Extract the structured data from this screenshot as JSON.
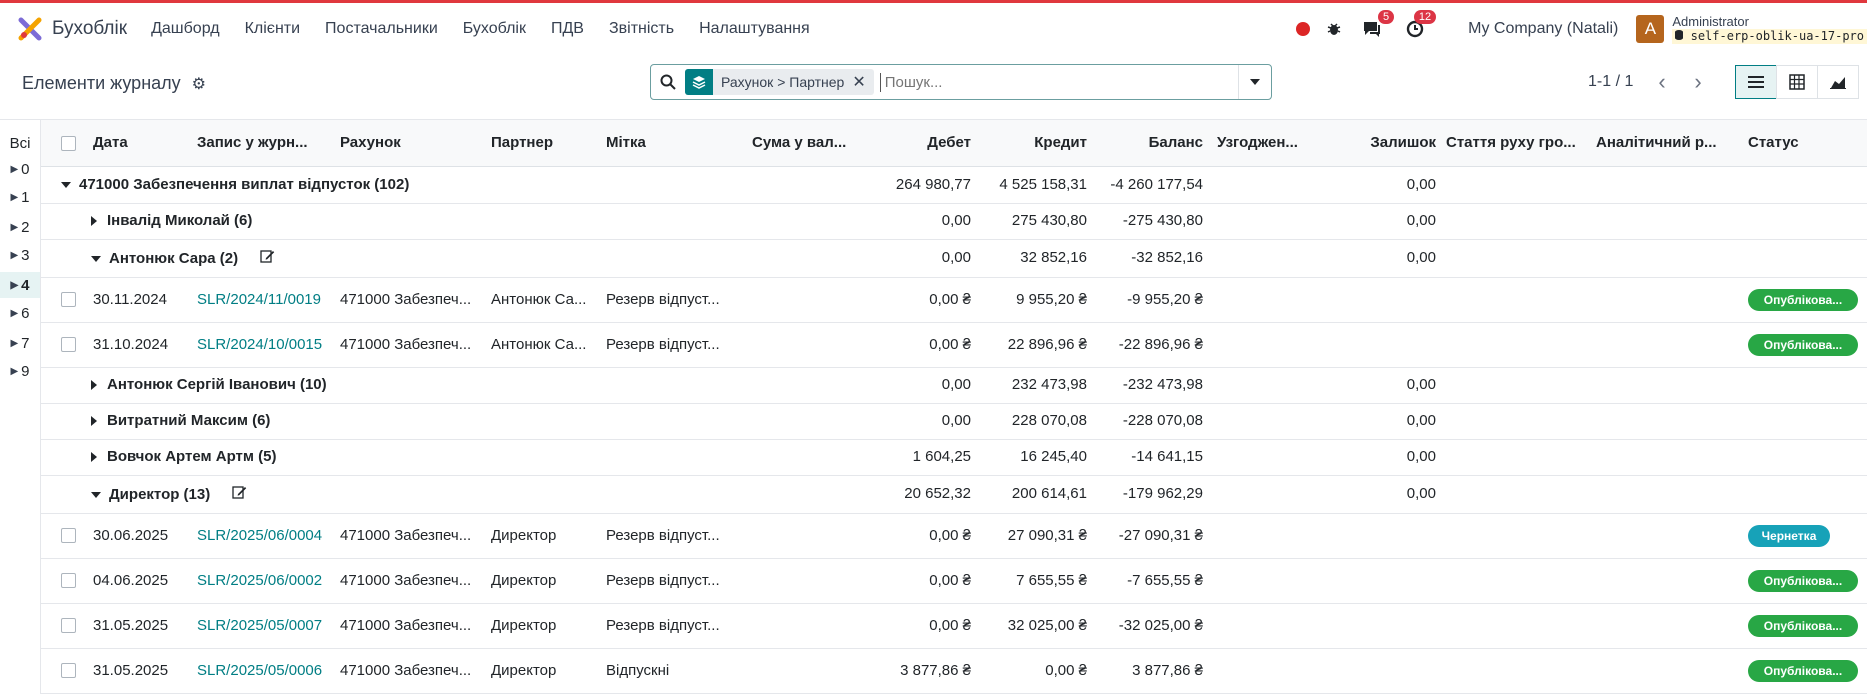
{
  "app": {
    "brand": "Бухоблік",
    "menu": [
      "Дашборд",
      "Клієнти",
      "Постачальники",
      "Бухоблік",
      "ПДВ",
      "Звітність",
      "Налаштування"
    ],
    "messages_count": "5",
    "activities_count": "12",
    "company": "My Company (Natali)",
    "avatar_letter": "A",
    "user": "Administrator",
    "database": "self-erp-oblik-ua-17-pro"
  },
  "control": {
    "title": "Елементи журналу",
    "facet_label": "Рахунок > Партнер",
    "search_placeholder": "Пошук...",
    "pager": "1-1 / 1"
  },
  "groups_panel": [
    "Всі",
    "0",
    "1",
    "2",
    "3",
    "4",
    "6",
    "7",
    "9"
  ],
  "columns": {
    "date": "Дата",
    "move": "Запис у журн...",
    "account": "Рахунок",
    "partner": "Партнер",
    "label": "Мітка",
    "amount_currency": "Сума у вал...",
    "debit": "Дебет",
    "credit": "Кредит",
    "balance": "Баланс",
    "matching": "Узгоджен...",
    "residual": "Залишок",
    "cashflow": "Стаття руху гро...",
    "analytic": "Аналітичний р...",
    "status": "Статус"
  },
  "rows": [
    {
      "kind": "group1",
      "label": "471000 Забезпечення виплат відпусток (102)",
      "debit": "264 980,77",
      "credit": "4 525 158,31",
      "balance": "-4 260 177,54",
      "residual": "0,00"
    },
    {
      "kind": "group2",
      "label": "Інвалід Миколай (6)",
      "debit": "0,00",
      "credit": "275 430,80",
      "balance": "-275 430,80",
      "residual": "0,00"
    },
    {
      "kind": "group2open",
      "label": "Антонюк Сара (2)",
      "debit": "0,00",
      "credit": "32 852,16",
      "balance": "-32 852,16",
      "residual": "0,00"
    },
    {
      "kind": "line",
      "date": "30.11.2024",
      "move": "SLR/2024/11/0019",
      "account": "471000 Забезпеч...",
      "partner": "Антонюк Са...",
      "label": "Резерв відпуст...",
      "debit": "0,00 ₴",
      "credit": "9 955,20 ₴",
      "balance": "-9 955,20 ₴",
      "status": "Опублікова...",
      "status_color": "#28a745"
    },
    {
      "kind": "line",
      "date": "31.10.2024",
      "move": "SLR/2024/10/0015",
      "account": "471000 Забезпеч...",
      "partner": "Антонюк Са...",
      "label": "Резерв відпуст...",
      "debit": "0,00 ₴",
      "credit": "22 896,96 ₴",
      "balance": "-22 896,96 ₴",
      "status": "Опублікова...",
      "status_color": "#28a745"
    },
    {
      "kind": "group2",
      "label": "Антонюк Сергій Іванович (10)",
      "debit": "0,00",
      "credit": "232 473,98",
      "balance": "-232 473,98",
      "residual": "0,00"
    },
    {
      "kind": "group2",
      "label": "Витратний Максим (6)",
      "debit": "0,00",
      "credit": "228 070,08",
      "balance": "-228 070,08",
      "residual": "0,00"
    },
    {
      "kind": "group2",
      "label": "Вовчок Артем Артм (5)",
      "debit": "1 604,25",
      "credit": "16 245,40",
      "balance": "-14 641,15",
      "residual": "0,00"
    },
    {
      "kind": "group2open",
      "label": "Директор (13)",
      "debit": "20 652,32",
      "credit": "200 614,61",
      "balance": "-179 962,29",
      "residual": "0,00"
    },
    {
      "kind": "line",
      "date": "30.06.2025",
      "move": "SLR/2025/06/0004",
      "account": "471000 Забезпеч...",
      "partner": "Директор",
      "label": "Резерв відпуст...",
      "debit": "0,00 ₴",
      "credit": "27 090,31 ₴",
      "balance": "-27 090,31 ₴",
      "status": "Чернетка",
      "status_color": "#17a2b8"
    },
    {
      "kind": "line",
      "date": "04.06.2025",
      "move": "SLR/2025/06/0002",
      "account": "471000 Забезпеч...",
      "partner": "Директор",
      "label": "Резерв відпуст...",
      "debit": "0,00 ₴",
      "credit": "7 655,55 ₴",
      "balance": "-7 655,55 ₴",
      "status": "Опублікова...",
      "status_color": "#28a745"
    },
    {
      "kind": "line",
      "date": "31.05.2025",
      "move": "SLR/2025/05/0007",
      "account": "471000 Забезпеч...",
      "partner": "Директор",
      "label": "Резерв відпуст...",
      "debit": "0,00 ₴",
      "credit": "32 025,00 ₴",
      "balance": "-32 025,00 ₴",
      "status": "Опублікова...",
      "status_color": "#28a745"
    },
    {
      "kind": "line",
      "date": "31.05.2025",
      "move": "SLR/2025/05/0006",
      "account": "471000 Забезпеч...",
      "partner": "Директор",
      "label": "Відпускні",
      "debit": "3 877,86 ₴",
      "credit": "0,00 ₴",
      "balance": "3 877,86 ₴",
      "status": "Опублікова...",
      "status_color": "#28a745"
    }
  ]
}
